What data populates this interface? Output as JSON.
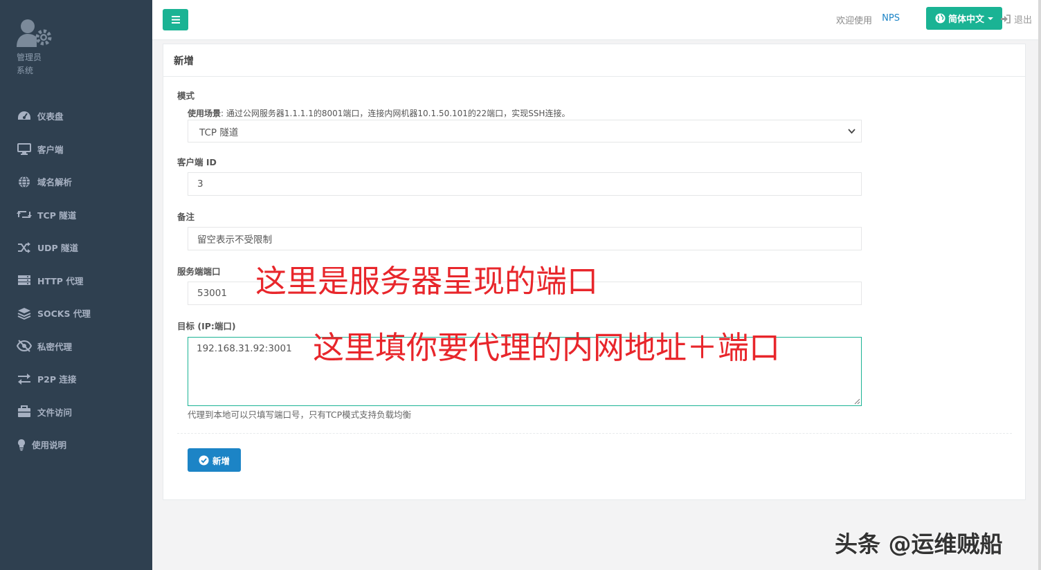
{
  "sidebar": {
    "profile_role": "管理员",
    "profile_sub": "系统",
    "items": [
      {
        "label": "仪表盘",
        "icon": "dashboard-icon"
      },
      {
        "label": "客户端",
        "icon": "desktop-icon"
      },
      {
        "label": "域名解析",
        "icon": "globe-icon"
      },
      {
        "label": "TCP 隧道",
        "icon": "retweet-icon"
      },
      {
        "label": "UDP 隧道",
        "icon": "shuffle-icon"
      },
      {
        "label": "HTTP 代理",
        "icon": "server-icon"
      },
      {
        "label": "SOCKS 代理",
        "icon": "layers-icon"
      },
      {
        "label": "私密代理",
        "icon": "eye-slash-icon"
      },
      {
        "label": "P2P 连接",
        "icon": "exchange-icon"
      },
      {
        "label": "文件访问",
        "icon": "briefcase-icon"
      },
      {
        "label": "使用说明",
        "icon": "lightbulb-icon"
      }
    ]
  },
  "topbar": {
    "welcome": "欢迎使用",
    "brand": "NPS",
    "language": "简体中文",
    "logout": "退出"
  },
  "form": {
    "title": "新增",
    "mode_label": "模式",
    "usage_prefix": "使用场景",
    "usage_text": ": 通过公网服务器1.1.1.1的8001端口，连接内网机器10.1.50.101的22端口，实现SSH连接。",
    "mode_value": "TCP 隧道",
    "client_id_label": "客户端 ID",
    "client_id_value": "3",
    "remark_label": "备注",
    "remark_placeholder": "留空表示不受限制",
    "server_port_label": "服务端端口",
    "server_port_value": "53001",
    "target_label": "目标 (IP:端口)",
    "target_value": "192.168.31.92:3001",
    "target_help": "代理到本地可以只填写端口号，只有TCP模式支持负载均衡",
    "submit_label": "新增"
  },
  "annotations": {
    "port_note": "这里是服务器呈现的端口",
    "target_note": "这里填你要代理的内网地址＋端口"
  },
  "watermark": "头条 @运维贼船",
  "colors": {
    "sidebar_bg": "#2f4050",
    "primary_green": "#1ab394",
    "primary_blue": "#1c84c6",
    "annotation_red": "#e8262b"
  }
}
